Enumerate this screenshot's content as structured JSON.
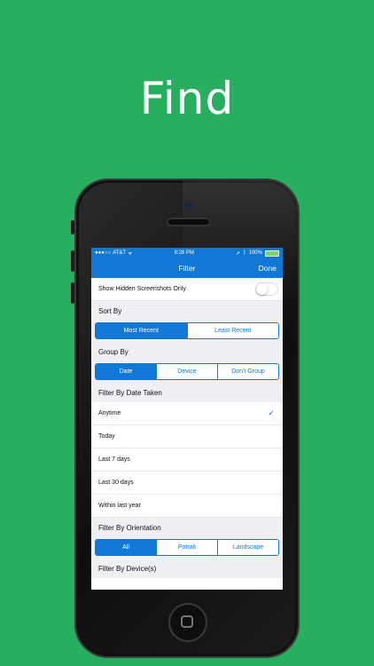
{
  "headline": "Find",
  "status_bar": {
    "carrier": "AT&T",
    "time": "8:28 PM",
    "battery": "100%"
  },
  "nav": {
    "title": "Filter",
    "done": "Done"
  },
  "hidden_toggle": {
    "label": "Show Hidden Screenshots Only",
    "on": false
  },
  "sort_by": {
    "header": "Sort By",
    "options": [
      "Most Recent",
      "Least Recent"
    ],
    "selected": "Most Recent"
  },
  "group_by": {
    "header": "Group By",
    "options": [
      "Date",
      "Device",
      "Don't Group"
    ],
    "selected": "Date"
  },
  "date_taken": {
    "header": "Filter By Date Taken",
    "options": [
      "Anytime",
      "Today",
      "Last 7 days",
      "Last 30 days",
      "Within last year"
    ],
    "selected": "Anytime"
  },
  "orientation": {
    "header": "Filter By Orientation",
    "options": [
      "All",
      "Potrait",
      "Landscape"
    ],
    "selected": "All"
  },
  "devices": {
    "header": "Filter By Device(s)"
  },
  "colors": {
    "background": "#27ae5f",
    "accent": "#1178d5"
  }
}
